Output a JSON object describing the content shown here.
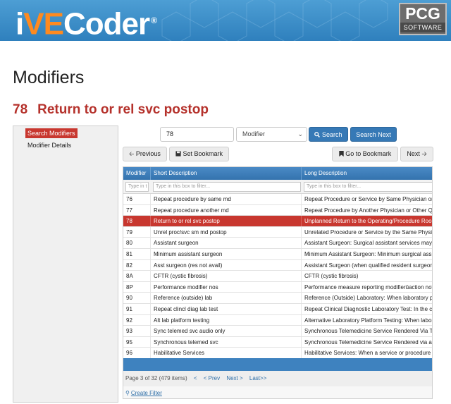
{
  "header": {
    "logo_prefix": "i",
    "logo_ve": "VE",
    "logo_suffix": "Coder",
    "logo_reg": "®",
    "vendor_big": "PCG",
    "vendor_small": "SOFTWARE",
    "logo_accent_color": "#ff8a1f"
  },
  "page": {
    "title": "Modifiers",
    "modifier_code": "78",
    "modifier_title": "Return to or rel svc postop"
  },
  "sidebar": {
    "items": [
      {
        "label": "Search Modifiers",
        "active": true
      },
      {
        "label": "Modifier Details",
        "active": false
      }
    ]
  },
  "search": {
    "value": "78",
    "field_selected": "Modifier",
    "search_label": "Search",
    "search_next_label": "Search Next"
  },
  "nav": {
    "previous_label": "Previous",
    "set_bookmark_label": "Set Bookmark",
    "goto_bookmark_label": "Go to Bookmark",
    "next_label": "Next"
  },
  "table": {
    "headers": [
      "Modifier",
      "Short Description",
      "Long Description"
    ],
    "filter_placeholders": [
      "Type in t",
      "Type in this box to filter...",
      "Type in this box to filter..."
    ],
    "rows": [
      [
        "76",
        "Repeat procedure by same md",
        "Repeat Procedure or Service by Same Physician or Oth"
      ],
      [
        "77",
        "Repeat procedure another md",
        "Repeat Procedure by Another Physician or Other Quali"
      ],
      [
        "78",
        "Return to or rel svc postop",
        "Unplanned Return to the Operating/Procedure Room b"
      ],
      [
        "79",
        "Unrel proc/svc sm md postop",
        "Unrelated Procedure or Service by the Same Physician"
      ],
      [
        "80",
        "Assistant surgeon",
        "Assistant Surgeon: Surgical assistant services may be"
      ],
      [
        "81",
        "Minimum assistant surgeon",
        "Minimum Assistant Surgeon: Minimum surgical assista"
      ],
      [
        "82",
        "Asst surgeon (res not avail)",
        "Assistant Surgeon (when qualified resident surgeon no"
      ],
      [
        "8A",
        "CFTR (cystic fibrosis)",
        "CFTR (cystic fibrosis)"
      ],
      [
        "8P",
        "Performance modifier nos",
        "Performance measure reporting modifierûaction not p"
      ],
      [
        "90",
        "Reference (outside) lab",
        "Reference (Outside) Laboratory: When laboratory proc"
      ],
      [
        "91",
        "Repeat clincl diag lab test",
        "Repeat Clinical Diagnostic Laboratory Test: In the cou"
      ],
      [
        "92",
        "Alt lab platform testing",
        "Alternative Laboratory Platform Testing: When laborat"
      ],
      [
        "93",
        "Sync telemed svc audio only",
        "Synchronous Telemedicine Service Rendered Via Telep"
      ],
      [
        "95",
        "Synchronous telemed svc",
        "Synchronous Telemedicine Service Rendered via a Rea"
      ],
      [
        "96",
        "Habilitative Services",
        "Habilitative Services: When a service or procedure tha"
      ]
    ],
    "selected_index": 2
  },
  "pager": {
    "info": "Page 3 of 32 (479 items)",
    "first": "<",
    "prev": "< Prev",
    "next": "Next >",
    "last": "Last>>"
  },
  "filter": {
    "create_label": "Create Filter"
  },
  "colors": {
    "accent_red": "#c8372f",
    "header_blue": "#3473ae",
    "button_blue": "#3679b6"
  }
}
